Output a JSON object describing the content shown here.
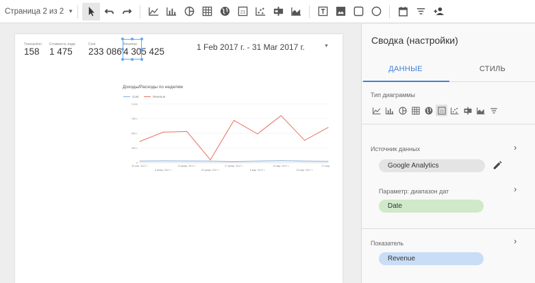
{
  "toolbar": {
    "page_selector": "Страница 2 из 2",
    "icons": [
      "cursor-icon",
      "undo-icon",
      "redo-icon",
      "time-series-icon",
      "bar-chart-icon",
      "pie-chart-icon",
      "table-icon",
      "geo-map-icon",
      "scorecard-icon",
      "scatter-chart-icon",
      "bullet-chart-icon",
      "area-chart-icon",
      "text-icon",
      "image-icon",
      "rectangle-icon",
      "circle-icon",
      "date-range-icon",
      "filter-icon",
      "add-user-icon"
    ]
  },
  "report": {
    "scorecards": [
      {
        "label": "Transaction",
        "value": "158"
      },
      {
        "label": "Стоимость лида",
        "value": "1 475"
      },
      {
        "label": "Cost",
        "value": "233 086"
      },
      {
        "label": "Revenue",
        "value": "4 305 425"
      }
    ],
    "date_range": "1 Feb 2017 г. - 31 Mar 2017 г.",
    "chart_title": "Доходы/Расходы по неделям"
  },
  "chart_data": {
    "type": "line",
    "title": "Доходы/Расходы по неделям",
    "x": [
      "30 янв. 2017 г.",
      "6 февр. 2017 г.",
      "13 февр. 2017 г.",
      "20 февр. 2017 г.",
      "27 февр. 2017 г.",
      "6 мар. 2017 г.",
      "13 мар. 2017 г.",
      "20 мар. 2017 г.",
      "27 мар."
    ],
    "y_ticks": [
      "0",
      "250 т.",
      "500 т.",
      "750 т.",
      "1 млн"
    ],
    "ylim": [
      0,
      1000000
    ],
    "series": [
      {
        "name": "Cost",
        "color": "#7cabdf",
        "values": [
          25000,
          30000,
          28000,
          25000,
          18000,
          25000,
          35000,
          25000,
          22000
        ]
      },
      {
        "name": "Revenue",
        "color": "#e8705f",
        "values": [
          360000,
          520000,
          530000,
          50000,
          720000,
          490000,
          800000,
          380000,
          600000
        ]
      }
    ],
    "legend": "top-left",
    "grid": true
  },
  "panel": {
    "title": "Сводка (настройки)",
    "tab_data": "ДАННЫЕ",
    "tab_style": "СТИЛЬ",
    "chart_type_label": "Тип диаграммы",
    "chart_type_icons": [
      "time-series-icon",
      "bar-chart-icon",
      "pie-chart-icon",
      "table-icon",
      "geo-map-icon",
      "scorecard-icon",
      "scatter-chart-icon",
      "bullet-chart-icon",
      "area-chart-icon",
      "filter-icon"
    ],
    "data_source_label": "Источник данных",
    "data_source_value": "Google Analytics",
    "date_param_label": "Параметр: диапазон дат",
    "date_param_value": "Date",
    "metric_label": "Показатель",
    "metric_value": "Revenue",
    "chevron": "›"
  }
}
